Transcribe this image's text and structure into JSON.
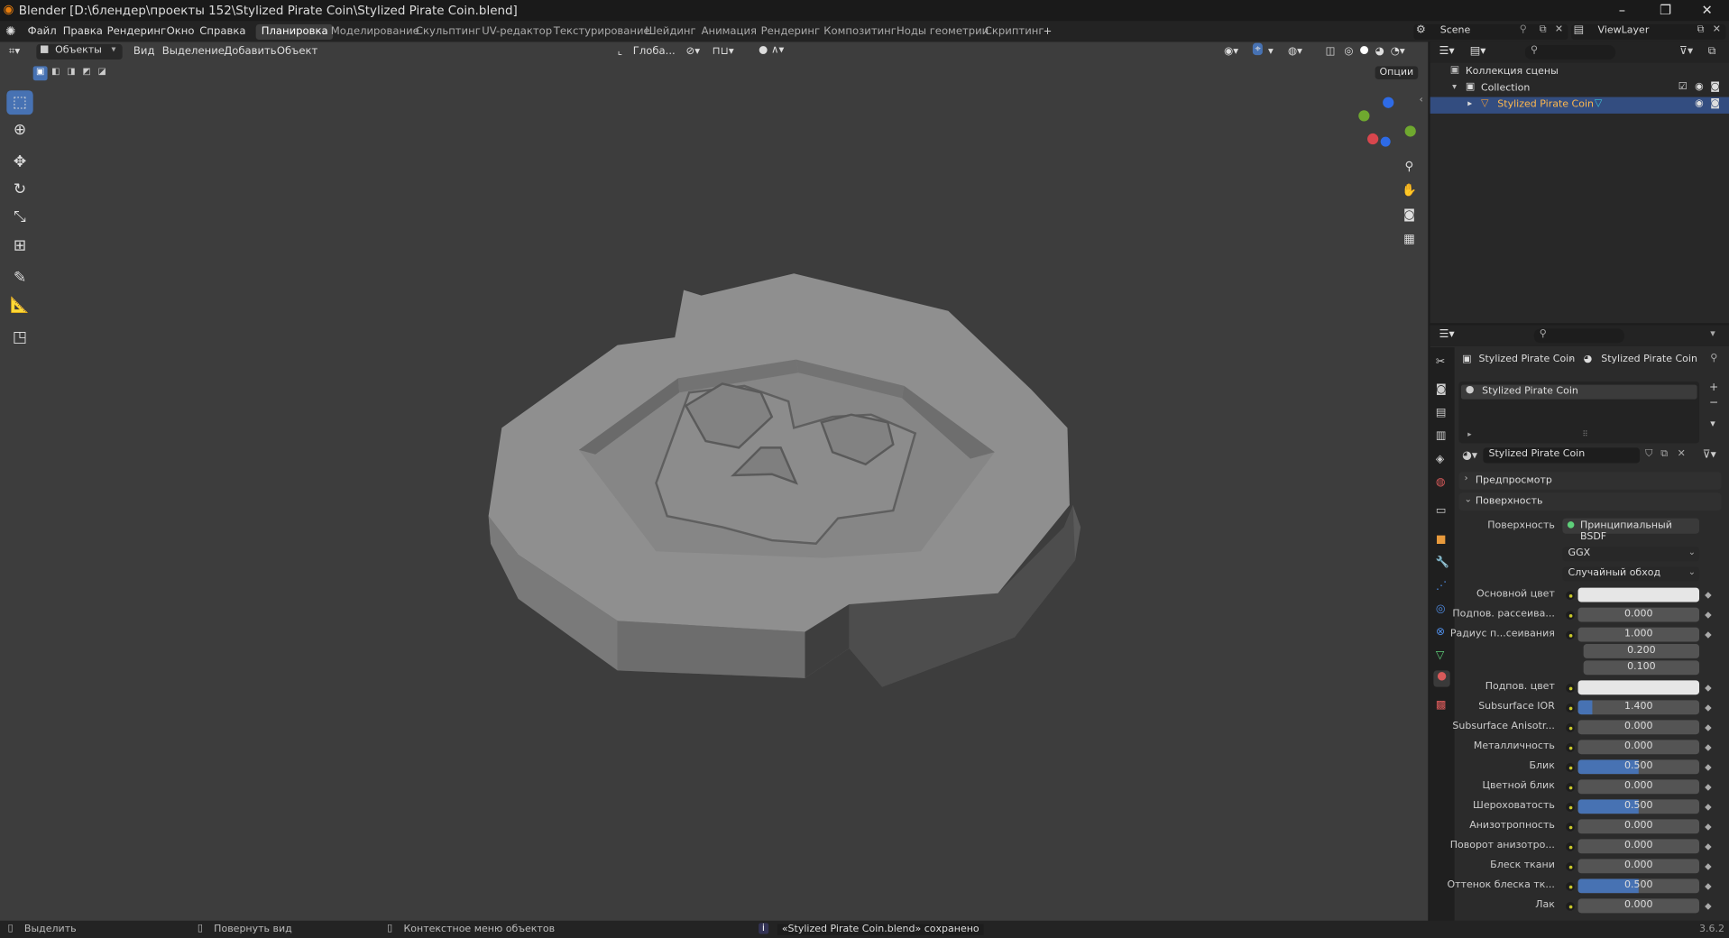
{
  "window": {
    "title": "Blender [D:\\блендер\\проекты 152\\Stylized Pirate Coin\\Stylized Pirate Coin.blend]",
    "minimize": "–",
    "restore": "❐",
    "close": "✕"
  },
  "menu": [
    "Файл",
    "Правка",
    "Рендеринг",
    "Окно",
    "Справка"
  ],
  "workspaces": [
    "Планировка",
    "Моделирование",
    "Скульптинг",
    "UV-редактор",
    "Текстурирование",
    "Шейдинг",
    "Анимация",
    "Рендеринг",
    "Композитинг",
    "Ноды геометрии",
    "Скриптинг",
    "+"
  ],
  "active_workspace": "Планировка",
  "scene": {
    "label": "Scene",
    "view_layer": "ViewLayer"
  },
  "viewport_header": {
    "mode": "Объекты",
    "items": [
      "Вид",
      "Выделение",
      "Добавить",
      "Объект"
    ],
    "transform": "Глоба...",
    "options": "Опции"
  },
  "outliner": {
    "root": "Коллекция сцены",
    "collection": "Collection",
    "object": "Stylized Pirate Coin"
  },
  "properties": {
    "breadcrumb_object": "Stylized Pirate Coin",
    "breadcrumb_material": "Stylized Pirate Coin",
    "slot": "Stylized Pirate Coin",
    "material_name": "Stylized Pirate Coin",
    "panel_preview": "Предпросмотр",
    "panel_surface": "Поверхность",
    "surface_label": "Поверхность",
    "surface_value": "Принципиальный BSDF",
    "distribution": "GGX",
    "subsurface_method": "Случайный обход",
    "rows": [
      {
        "label": "Основной цвет",
        "value": "",
        "kind": "color"
      },
      {
        "label": "Подпов. рассеива...",
        "value": "0.000",
        "fill": 0
      },
      {
        "label": "Радиус п...сеивания",
        "value": "1.000",
        "fill": 0,
        "extra": [
          "0.200",
          "0.100"
        ]
      },
      {
        "label": "Подпов. цвет",
        "value": "",
        "kind": "color"
      },
      {
        "label": "Subsurface IOR",
        "value": "1.400",
        "fill": 0.12
      },
      {
        "label": "Subsurface Anisotr...",
        "value": "0.000",
        "fill": 0
      },
      {
        "label": "Металличность",
        "value": "0.000",
        "fill": 0
      },
      {
        "label": "Блик",
        "value": "0.500",
        "fill": 0.5
      },
      {
        "label": "Цветной блик",
        "value": "0.000",
        "fill": 0
      },
      {
        "label": "Шероховатость",
        "value": "0.500",
        "fill": 0.5
      },
      {
        "label": "Анизотропность",
        "value": "0.000",
        "fill": 0
      },
      {
        "label": "Поворот анизотро...",
        "value": "0.000",
        "fill": 0
      },
      {
        "label": "Блеск ткани",
        "value": "0.000",
        "fill": 0
      },
      {
        "label": "Оттенок блеска тк...",
        "value": "0.500",
        "fill": 0.5
      },
      {
        "label": "Лак",
        "value": "0.000",
        "fill": 0
      }
    ]
  },
  "status": {
    "select": "Выделить",
    "rotate": "Повернуть вид",
    "context": "Контекстное меню объектов",
    "message": "«Stylized Pirate Coin.blend» сохранено",
    "version": "3.6.2"
  },
  "colors": {
    "accent": "#4772b3",
    "viewport_bg": "#3d3d3d",
    "coin": "#8c8c8c"
  }
}
